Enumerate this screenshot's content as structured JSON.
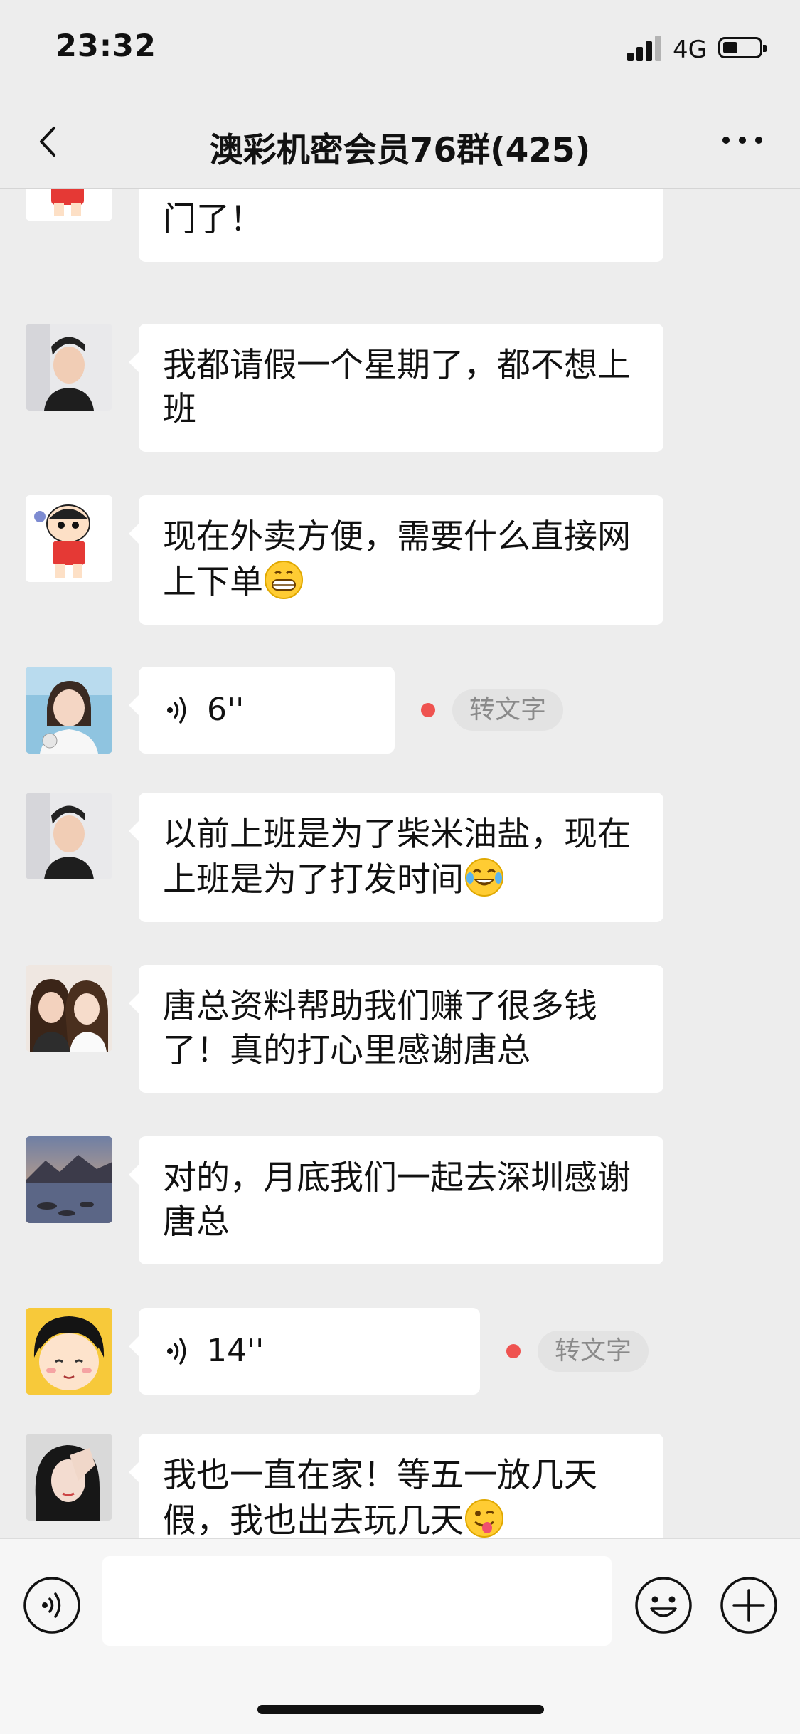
{
  "status_bar": {
    "time": "23:32",
    "network": "4G",
    "signal_icon": "signal-bars-icon",
    "battery_icon": "battery-icon"
  },
  "header": {
    "title": "澳彩机密会员76群(425)",
    "back_icon": "chevron-left-icon",
    "more_icon": "more-dots-icon"
  },
  "messages": [
    {
      "type": "text",
      "avatar": "crayon-shinchan",
      "text": "这几天感冒了！宅在家里！不出门了！"
    },
    {
      "type": "text",
      "avatar": "young-man",
      "text": "我都请假一个星期了，都不想上班"
    },
    {
      "type": "text",
      "avatar": "crayon-shinchan",
      "text": "现在外卖方便，需要什么直接网上下单",
      "emoji": "grinning-emoji"
    },
    {
      "type": "voice",
      "avatar": "woman-selfie",
      "duration": "6''",
      "action": "转文字"
    },
    {
      "type": "text",
      "avatar": "young-man",
      "text": "以前上班是为了柴米油盐，现在上班是为了打发时间",
      "emoji": "tears-of-joy-emoji"
    },
    {
      "type": "text",
      "avatar": "two-women",
      "text": "唐总资料帮助我们赚了很多钱了！真的打心里感谢唐总"
    },
    {
      "type": "text",
      "avatar": "lake-landscape",
      "text": "对的，月底我们一起去深圳感谢唐总"
    },
    {
      "type": "voice",
      "avatar": "cartoon-girl",
      "duration": "14''",
      "action": "转文字"
    },
    {
      "type": "text",
      "avatar": "woman-hand-face",
      "text": "我也一直在家！等五一放几天假，我也出去玩几天",
      "emoji": "winking-tongue-emoji"
    }
  ],
  "input_bar": {
    "text_value": "",
    "voice_icon": "voice-input-icon",
    "emoji_icon": "emoji-icon",
    "plus_icon": "plus-icon"
  },
  "colors": {
    "background": "#ededed",
    "bubble": "#ffffff",
    "unread_dot": "#ef5350"
  }
}
